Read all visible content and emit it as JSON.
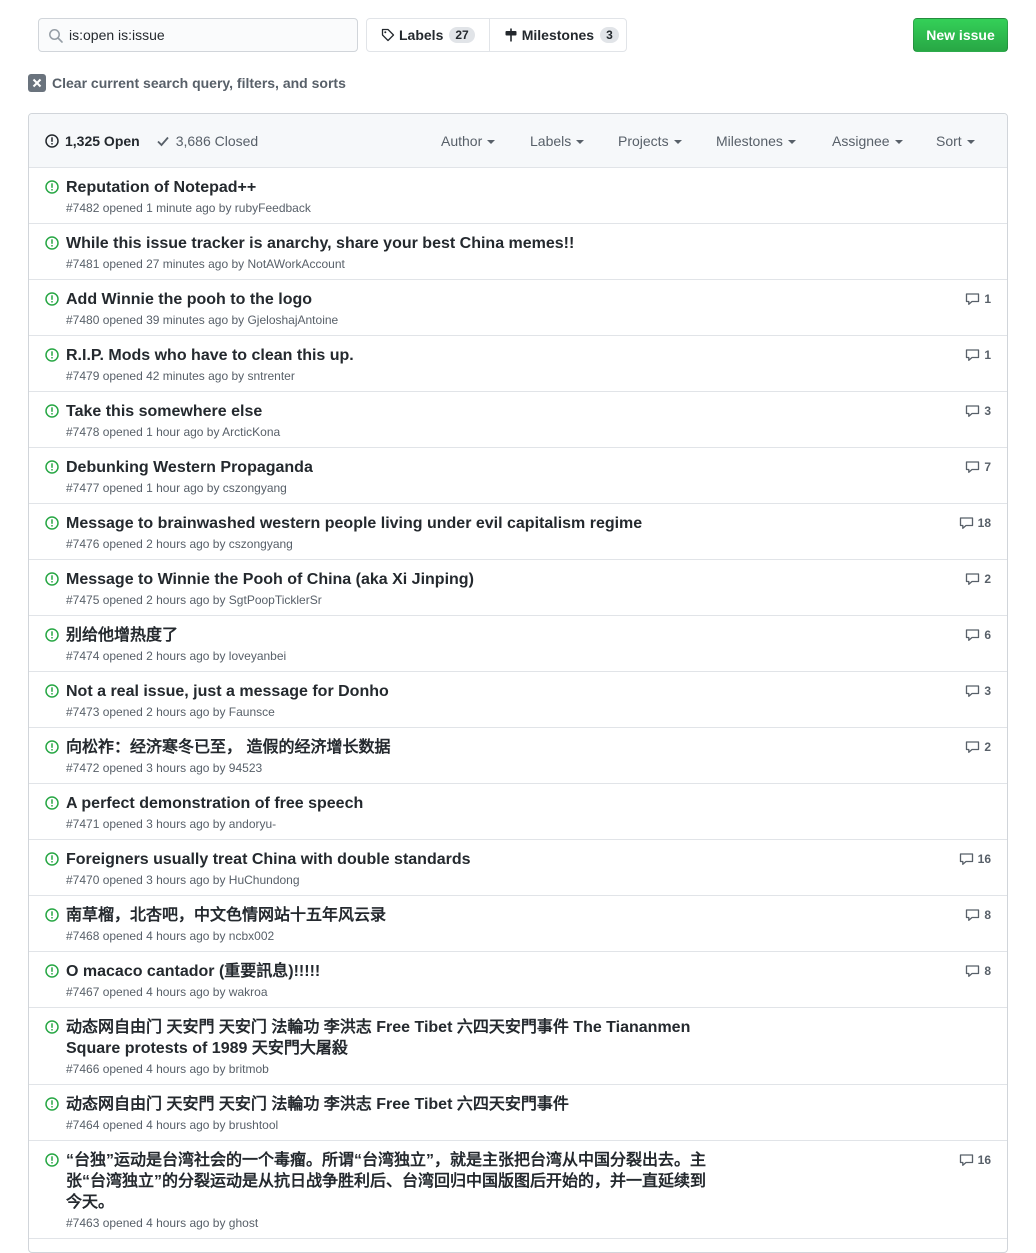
{
  "search": {
    "query": "is:open is:issue"
  },
  "nav": {
    "labels": "Labels",
    "labels_count": "27",
    "milestones": "Milestones",
    "milestones_count": "3"
  },
  "new_issue": "New issue",
  "clear_query": "Clear current search query, filters, and sorts",
  "header": {
    "open": "1,325 Open",
    "closed": "3,686 Closed",
    "filters": [
      "Author",
      "Labels",
      "Projects",
      "Milestones",
      "Assignee",
      "Sort"
    ]
  },
  "issues": [
    {
      "title": "Reputation of Notepad++",
      "meta": "#7482 opened 1 minute ago by rubyFeedback",
      "comments": ""
    },
    {
      "title": "While this issue tracker is anarchy, share your best China memes!!",
      "meta": "#7481 opened 27 minutes ago by NotAWorkAccount",
      "comments": ""
    },
    {
      "title": "Add Winnie the pooh to the logo",
      "meta": "#7480 opened 39 minutes ago by GjeloshajAntoine",
      "comments": "1"
    },
    {
      "title": "R.I.P. Mods who have to clean this up.",
      "meta": "#7479 opened 42 minutes ago by sntrenter",
      "comments": "1"
    },
    {
      "title": "Take this somewhere else",
      "meta": "#7478 opened 1 hour ago by ArcticKona",
      "comments": "3"
    },
    {
      "title": "Debunking Western Propaganda",
      "meta": "#7477 opened 1 hour ago by cszongyang",
      "comments": "7"
    },
    {
      "title": "Message to brainwashed western people living under evil capitalism regime",
      "meta": "#7476 opened 2 hours ago by cszongyang",
      "comments": "18"
    },
    {
      "title": "Message to Winnie the Pooh of China (aka Xi Jinping)",
      "meta": "#7475 opened 2 hours ago by SgtPoopTicklerSr",
      "comments": "2"
    },
    {
      "title": "别给他增热度了",
      "meta": "#7474 opened 2 hours ago by loveyanbei",
      "comments": "6"
    },
    {
      "title": "Not a real issue, just a message for Donho",
      "meta": "#7473 opened 2 hours ago by Faunsce",
      "comments": "3"
    },
    {
      "title": "向松祚：经济寒冬已至， 造假的经济增长数据",
      "meta": "#7472 opened 3 hours ago by 94523",
      "comments": "2"
    },
    {
      "title": "A perfect demonstration of free speech",
      "meta": "#7471 opened 3 hours ago by andoryu-",
      "comments": ""
    },
    {
      "title": "Foreigners usually treat China with double standards",
      "meta": "#7470 opened 3 hours ago by HuChundong",
      "comments": "16"
    },
    {
      "title": "南草榴，北杏吧，中文色情网站十五年风云录",
      "meta": "#7468 opened 4 hours ago by ncbx002",
      "comments": "8"
    },
    {
      "title": "O macaco cantador (重要訊息)!!!!!",
      "meta": "#7467 opened 4 hours ago by wakroa",
      "comments": "8"
    },
    {
      "title": "动态网自由门 天安門 天安门 法輪功 李洪志 Free Tibet 六四天安門事件 The Tiananmen Square protests of 1989 天安門大屠殺",
      "meta": "#7466 opened 4 hours ago by britmob",
      "comments": ""
    },
    {
      "title": "动态网自由门 天安門 天安门 法輪功 李洪志 Free Tibet 六四天安門事件",
      "meta": "#7464 opened 4 hours ago by brushtool",
      "comments": ""
    },
    {
      "title": "“台独”运动是台湾社会的一个毒瘤。所谓“台湾独立”，就是主张把台湾从中国分裂出去。主张“台湾独立”的分裂运动是从抗日战争胜利后、台湾回归中国版图后开始的，并一直延续到今天。",
      "meta": "#7463 opened 4 hours ago by ghost",
      "comments": "16"
    }
  ]
}
